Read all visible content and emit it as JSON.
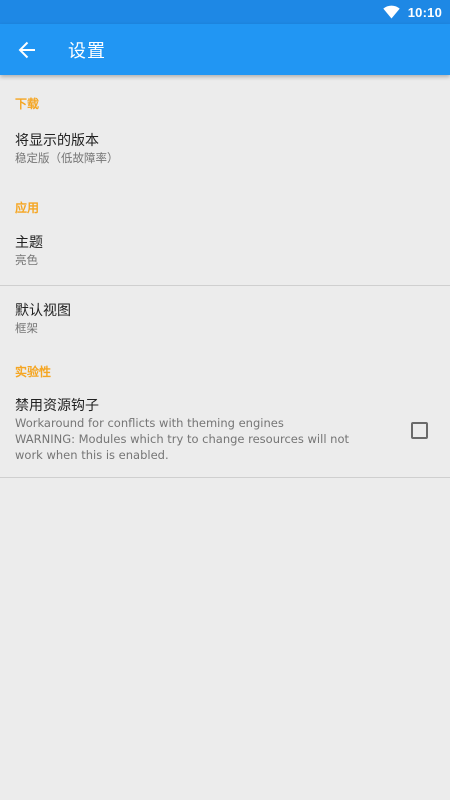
{
  "status_bar": {
    "time": "10:10",
    "icons": [
      "wifi-icon"
    ]
  },
  "app_bar": {
    "title": "设置",
    "back_icon": "arrow-back-icon",
    "color": "#2196f3"
  },
  "categories": {
    "download": "下载",
    "app": "应用",
    "experimental": "实验性"
  },
  "preferences": {
    "version": {
      "title": "将显示的版本",
      "summary": "稳定版（低故障率）"
    },
    "theme": {
      "title": "主题",
      "summary": "亮色"
    },
    "default_view": {
      "title": "默认视图",
      "summary": "框架"
    },
    "disable_resource_hooks": {
      "title": "禁用资源钩子",
      "summary_line1": "Workaround for conflicts with theming engines",
      "summary_line2": "WARNING: Modules which try to change resources will not work when this is enabled.",
      "checked": false
    }
  },
  "colors": {
    "accent": "#f5a623",
    "primary": "#2196f3",
    "primary_dark": "#1e88e5"
  }
}
